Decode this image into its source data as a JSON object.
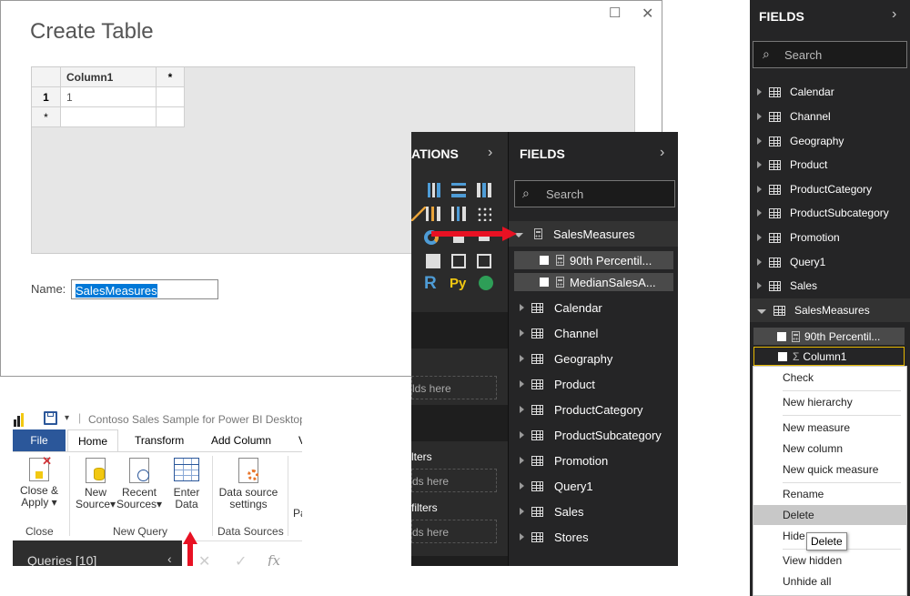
{
  "create_table": {
    "title": "Create Table",
    "maximize_glyph": "☐",
    "close_glyph": "✕",
    "col_header": "Column1",
    "add_col": "*",
    "row1_num": "1",
    "row1_val": "1",
    "new_row": "*",
    "name_label": "Name:",
    "name_value": "SalesMeasures"
  },
  "ribbon": {
    "app_title": "Contoso Sales Sample for Power BI Desktop",
    "tabs": [
      "File",
      "Home",
      "Transform",
      "Add Column"
    ],
    "close_apply": "Close &",
    "close_apply2": "Apply",
    "close_group": "Close",
    "new_source": "New",
    "new_source2": "Source",
    "recent_sources": "Recent",
    "recent_sources2": "Sources",
    "enter_data": "Enter",
    "enter_data2": "Data",
    "new_query_group": "New Query",
    "ds_settings": "Data source",
    "ds_settings2": "settings",
    "data_sources_group": "Data Sources",
    "pa_cut": "Pa",
    "queries": "Queries [10]",
    "fx": "fx"
  },
  "middle": {
    "viz_title_cut": "ATIONS",
    "fields_title": "FIELDS",
    "search_placeholder": "Search",
    "measures_table": "SalesMeasures",
    "measure1": "90th Percentil...",
    "measure2": "MedianSalesA...",
    "tables": [
      "Calendar",
      "Channel",
      "Geography",
      "Product",
      "ProductCategory",
      "ProductSubcategory",
      "Promotion",
      "Query1",
      "Sales",
      "Stores"
    ],
    "r_label": "R",
    "py_label": "Py",
    "drop1": "lds here",
    "filters": "lters",
    "drop2": "ds here",
    "filters2": "filters",
    "drop3": "ds here"
  },
  "right": {
    "fields_title": "FIELDS",
    "search_placeholder": "Search",
    "tables": [
      "Calendar",
      "Channel",
      "Geography",
      "Product",
      "ProductCategory",
      "ProductSubcategory",
      "Promotion",
      "Query1",
      "Sales",
      "SalesMeasures"
    ],
    "measure1": "90th Percentil...",
    "column1": "Column1",
    "menu": [
      "Check",
      "New hierarchy",
      "New measure",
      "New column",
      "New quick measure",
      "Rename",
      "Delete",
      "Hide",
      "View hidden",
      "Unhide all"
    ],
    "tooltip": "Delete"
  },
  "colors": {
    "accent": "#2b579a",
    "arrow": "#e81123",
    "panel": "#252526"
  }
}
